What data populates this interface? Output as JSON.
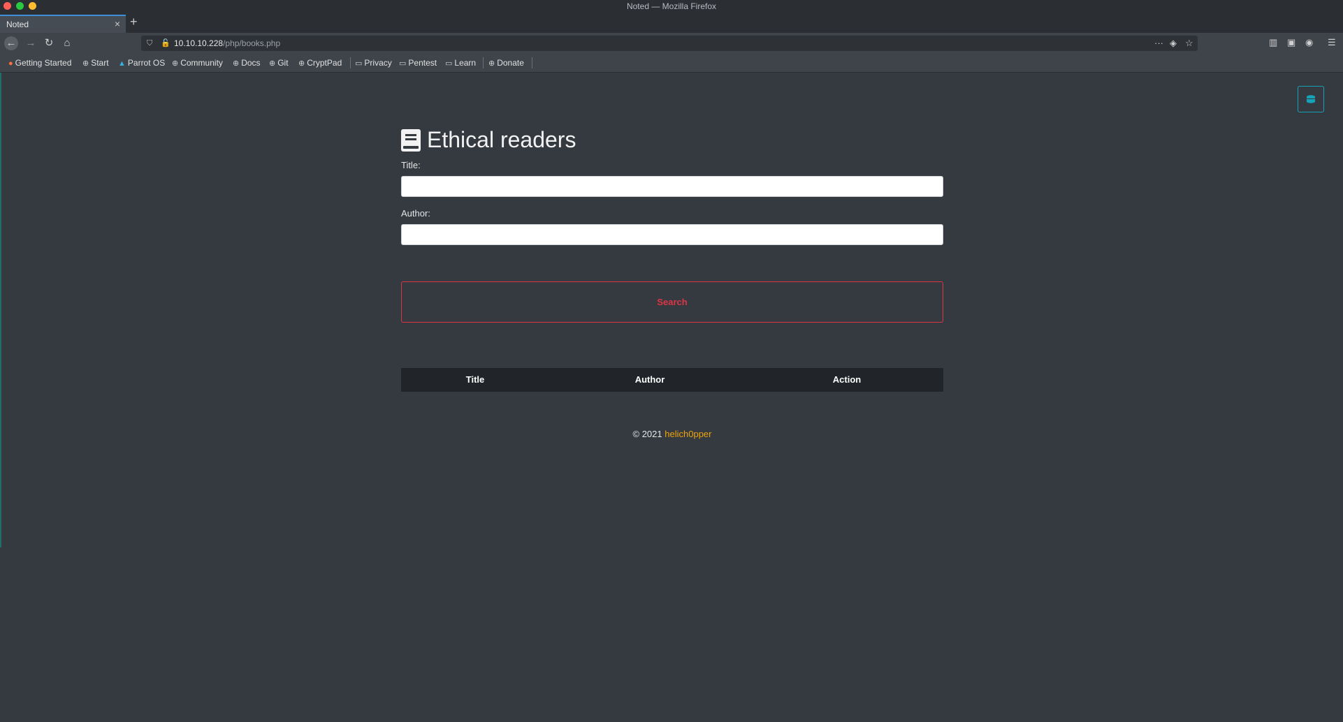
{
  "window": {
    "title": "Noted — Mozilla Firefox",
    "buttons": {
      "close_color": "#ff5f57",
      "minimize_color": "#28c840",
      "maximize_color": "#febc2e"
    }
  },
  "tabs": [
    {
      "label": "Noted",
      "active": true
    }
  ],
  "address_bar": {
    "host": "10.10.10.228",
    "path": "/php/books.php"
  },
  "bookmarks": [
    {
      "label": "Getting Started",
      "icon": "firefox-icon"
    },
    {
      "label": "Start",
      "icon": "globe-icon"
    },
    {
      "label": "Parrot OS",
      "icon": "parrot-icon"
    },
    {
      "label": "Community",
      "icon": "globe-icon"
    },
    {
      "label": "Docs",
      "icon": "globe-icon"
    },
    {
      "label": "Git",
      "icon": "globe-icon"
    },
    {
      "label": "CryptPad",
      "icon": "globe-icon"
    },
    {
      "label": "Privacy",
      "icon": "folder-icon"
    },
    {
      "label": "Pentest",
      "icon": "folder-icon"
    },
    {
      "label": "Learn",
      "icon": "folder-icon"
    },
    {
      "label": "Donate",
      "icon": "globe-icon"
    }
  ],
  "page": {
    "heading": "Ethical readers",
    "form": {
      "title_label": "Title:",
      "title_value": "",
      "author_label": "Author:",
      "author_value": "",
      "search_label": "Search"
    },
    "table": {
      "columns": [
        "Title",
        "Author",
        "Action"
      ],
      "rows": []
    },
    "footer": {
      "copyright": "© 2021",
      "author_link": "helich0pper"
    }
  },
  "colors": {
    "page_bg": "#343a40",
    "search_button": "#dc3545",
    "toggle_border": "#17a2b8",
    "footer_link": "#f0a30a",
    "table_header_bg": "#212529"
  }
}
